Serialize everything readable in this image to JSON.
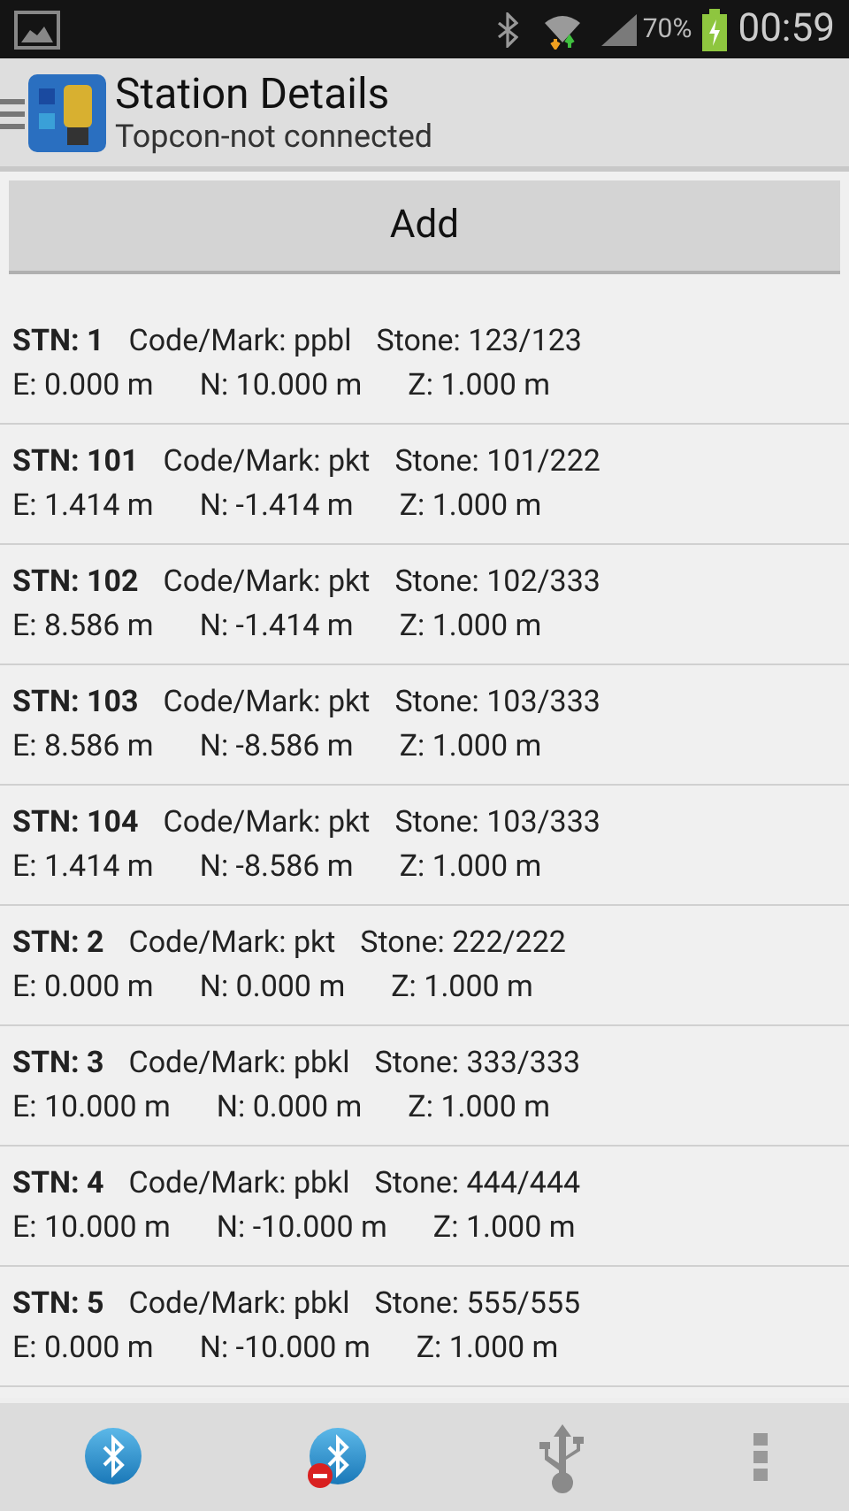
{
  "status_bar": {
    "battery": "70%",
    "time": "00:59"
  },
  "action_bar": {
    "title": "Station Details",
    "subtitle": "Topcon-not connected"
  },
  "add_button": "Add",
  "stations": [
    {
      "stn": "STN: 1",
      "code": "Code/Mark: ppbl",
      "stone": "Stone: 123/123",
      "e": "E: 0.000 m",
      "n": "N: 10.000 m",
      "z": "Z: 1.000 m"
    },
    {
      "stn": "STN: 101",
      "code": "Code/Mark: pkt",
      "stone": "Stone: 101/222",
      "e": "E: 1.414 m",
      "n": "N: -1.414 m",
      "z": "Z: 1.000 m"
    },
    {
      "stn": "STN: 102",
      "code": "Code/Mark: pkt",
      "stone": "Stone: 102/333",
      "e": "E: 8.586 m",
      "n": "N: -1.414 m",
      "z": "Z: 1.000 m"
    },
    {
      "stn": "STN: 103",
      "code": "Code/Mark: pkt",
      "stone": "Stone: 103/333",
      "e": "E: 8.586 m",
      "n": "N: -8.586 m",
      "z": "Z: 1.000 m"
    },
    {
      "stn": "STN: 104",
      "code": "Code/Mark: pkt",
      "stone": "Stone: 103/333",
      "e": "E: 1.414 m",
      "n": "N: -8.586 m",
      "z": "Z: 1.000 m"
    },
    {
      "stn": "STN: 2",
      "code": "Code/Mark: pkt",
      "stone": "Stone: 222/222",
      "e": "E: 0.000 m",
      "n": "N: 0.000 m",
      "z": "Z: 1.000 m"
    },
    {
      "stn": "STN: 3",
      "code": "Code/Mark: pbkl",
      "stone": "Stone: 333/333",
      "e": "E: 10.000 m",
      "n": "N: 0.000 m",
      "z": "Z: 1.000 m"
    },
    {
      "stn": "STN: 4",
      "code": "Code/Mark: pbkl",
      "stone": "Stone: 444/444",
      "e": "E: 10.000 m",
      "n": "N: -10.000 m",
      "z": "Z: 1.000 m"
    },
    {
      "stn": "STN: 5",
      "code": "Code/Mark: pbkl",
      "stone": "Stone: 555/555",
      "e": "E: 0.000 m",
      "n": "N: -10.000 m",
      "z": "Z: 1.000 m"
    }
  ]
}
